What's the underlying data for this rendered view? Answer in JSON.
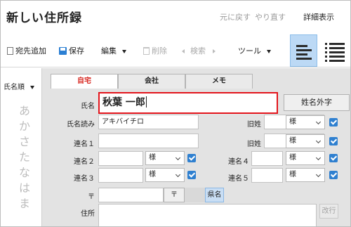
{
  "app": {
    "title": "新しい住所録",
    "undo_label": "元に戻す",
    "redo_label": "やり直す",
    "details_label": "詳細表示"
  },
  "toolbar": {
    "add_address_label": "宛先追加",
    "save_label": "保存",
    "edit_label": "編集",
    "delete_label": "削除",
    "search_label": "検索",
    "tool_label": "ツール"
  },
  "sidebar": {
    "sort_label": "氏名順",
    "kana_index": [
      "あ",
      "か",
      "さ",
      "た",
      "な",
      "は",
      "ま"
    ]
  },
  "tabs": [
    {
      "label": "自宅",
      "active": true
    },
    {
      "label": "会社",
      "active": false
    },
    {
      "label": "メモ",
      "active": false
    }
  ],
  "form": {
    "name_label": "氏名",
    "name_value": "秋葉 一郎",
    "nonstandard_char_button": "姓名外字",
    "reading_label": "氏名読み",
    "reading_value": "アキバイチロ",
    "former_surname_label_1": "旧姓",
    "former_surname_label_2": "旧姓",
    "joint_name_1_label": "連名１",
    "joint_name_2_label": "連名２",
    "joint_name_3_label": "連名３",
    "joint_name_4_label": "連名４",
    "joint_name_5_label": "連名５",
    "honorific_value": "様",
    "postal_label": "〒",
    "postal_button": "〒",
    "county_button": "県名",
    "address_label": "住所",
    "newline_button": "改行"
  },
  "colors": {
    "accent": "#2f80d0",
    "highlight_border": "#e3151c",
    "active_tab_text": "#d7261f",
    "panel_bg": "#e3e3e3"
  }
}
